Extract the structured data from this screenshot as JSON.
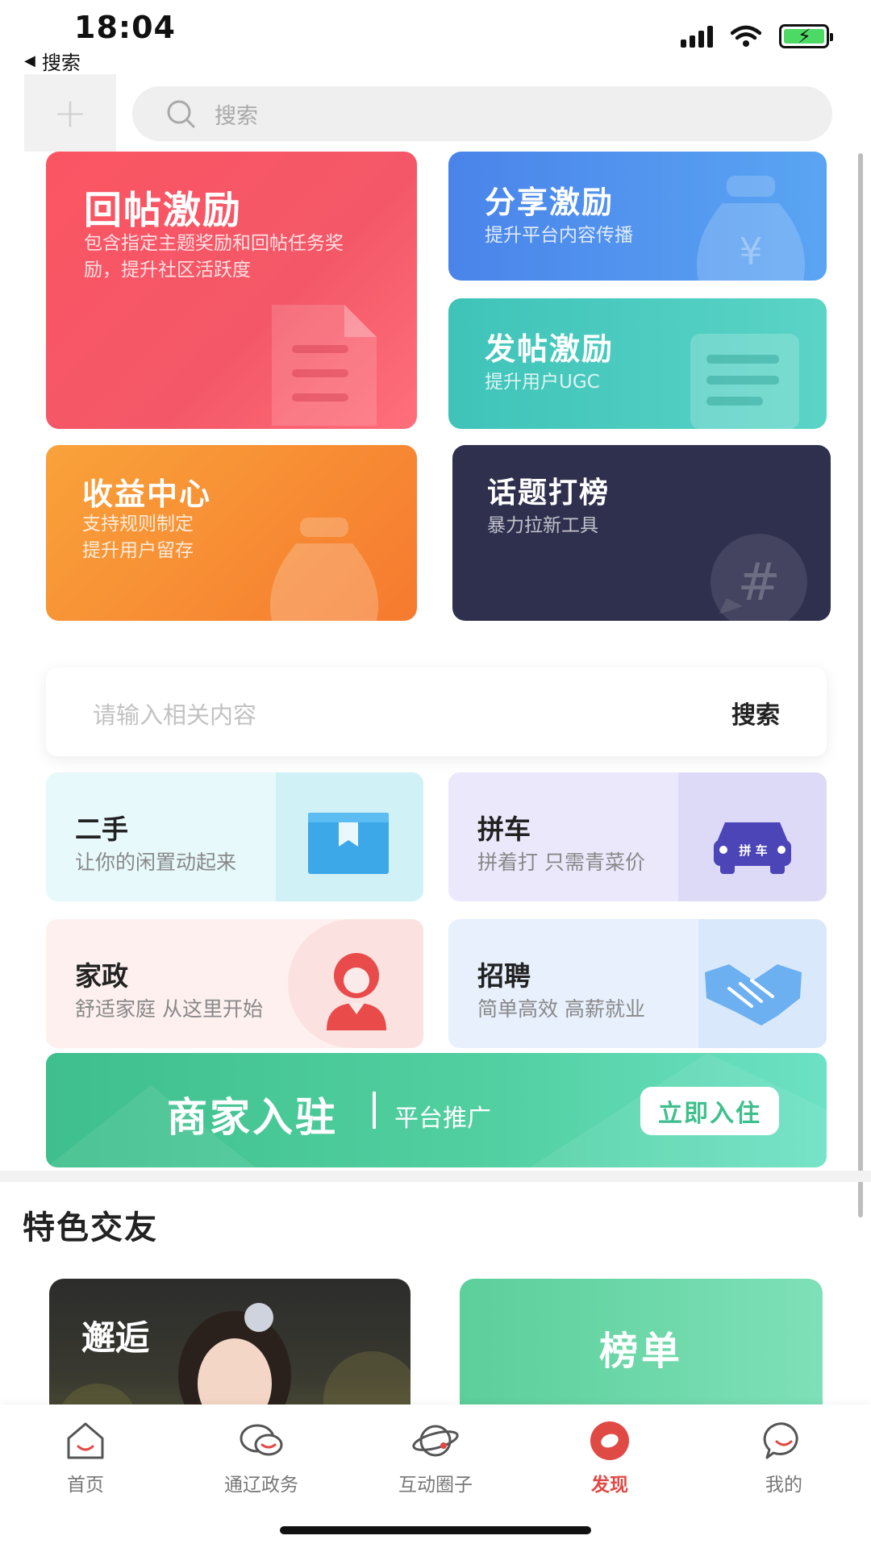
{
  "status_bar": {
    "time": "18:04",
    "back_label": "搜索"
  },
  "header": {
    "search_placeholder": "搜索"
  },
  "feature_cards": [
    {
      "title": "回帖激励",
      "desc": "包含指定主题奖励和回帖任务奖励，提升社区活跃度"
    },
    {
      "title": "分享激励",
      "desc": "提升平台内容传播"
    },
    {
      "title": "发帖激励",
      "desc": "提升用户UGC"
    },
    {
      "title": "收益中心",
      "desc": "支持规则制定\n提升用户留存"
    },
    {
      "title": "话题打榜",
      "desc": "暴力拉新工具"
    }
  ],
  "content_search": {
    "placeholder": "请输入相关内容",
    "button": "搜索"
  },
  "services": [
    {
      "title": "二手",
      "desc": "让你的闲置动起来"
    },
    {
      "title": "拼车",
      "desc": "拼着打 只需青菜价",
      "badge": "拼 车"
    },
    {
      "title": "家政",
      "desc": "舒适家庭 从这里开始"
    },
    {
      "title": "招聘",
      "desc": "简单高效 高薪就业"
    }
  ],
  "merchant_banner": {
    "title": "商家入驻",
    "subtitle": "平台推广",
    "button": "立即入住"
  },
  "friends_section": {
    "title": "特色交友",
    "cards": [
      {
        "title": "邂逅"
      },
      {
        "title": "榜单"
      }
    ]
  },
  "tabbar": {
    "active_color": "#e04a45",
    "items": [
      {
        "label": "首页",
        "icon": "home-icon"
      },
      {
        "label": "通辽政务",
        "icon": "chat-bubbles-icon"
      },
      {
        "label": "互动圈子",
        "icon": "planet-icon"
      },
      {
        "label": "发现",
        "icon": "discover-icon"
      },
      {
        "label": "我的",
        "icon": "smile-bubble-icon"
      }
    ]
  }
}
